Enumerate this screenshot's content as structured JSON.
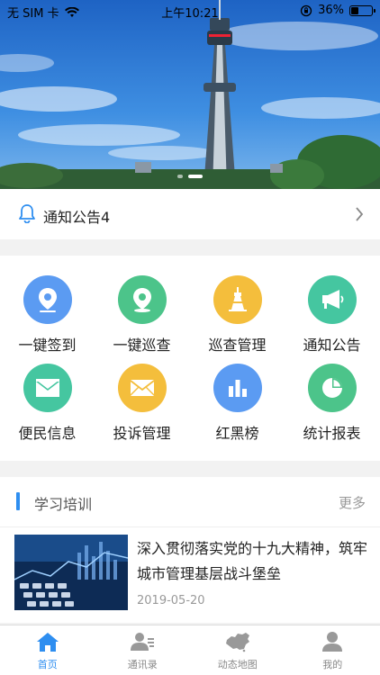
{
  "status": {
    "carrier": "无 SIM 卡",
    "time": "上午10:21",
    "battery_text": "36%",
    "battery_level": 0.36
  },
  "banner": {
    "slide_count": 2,
    "active_slide": 1
  },
  "notice": {
    "text": "通知公告4",
    "icon": "bell-icon"
  },
  "grid": {
    "items": [
      {
        "label": "一键签到",
        "icon": "location-pin-icon",
        "color": "#5b9bf2"
      },
      {
        "label": "一键巡查",
        "icon": "location-pin-icon",
        "color": "#4cc48a"
      },
      {
        "label": "巡查管理",
        "icon": "tower-icon",
        "color": "#f4be3c"
      },
      {
        "label": "通知公告",
        "icon": "megaphone-icon",
        "color": "#45c6a0"
      },
      {
        "label": "便民信息",
        "icon": "envelope-open-icon",
        "color": "#45c6a0"
      },
      {
        "label": "投诉管理",
        "icon": "envelope-icon",
        "color": "#f4be3c"
      },
      {
        "label": "红黑榜",
        "icon": "bar-chart-icon",
        "color": "#5b9bf2"
      },
      {
        "label": "统计报表",
        "icon": "pie-chart-icon",
        "color": "#4cc48a"
      }
    ]
  },
  "study": {
    "title": "学习培训",
    "more": "更多",
    "article": {
      "title": "深入贯彻落实党的十九大精神，筑牢城市管理基层战斗堡垒",
      "date": "2019-05-20"
    }
  },
  "tabs": [
    {
      "label": "首页",
      "icon": "home-icon",
      "active": true
    },
    {
      "label": "通讯录",
      "icon": "contacts-icon",
      "active": false
    },
    {
      "label": "动态地图",
      "icon": "china-map-icon",
      "active": false
    },
    {
      "label": "我的",
      "icon": "person-icon",
      "active": false
    }
  ],
  "colors": {
    "accent": "#2e8ef0",
    "background": "#f2f2f2"
  }
}
